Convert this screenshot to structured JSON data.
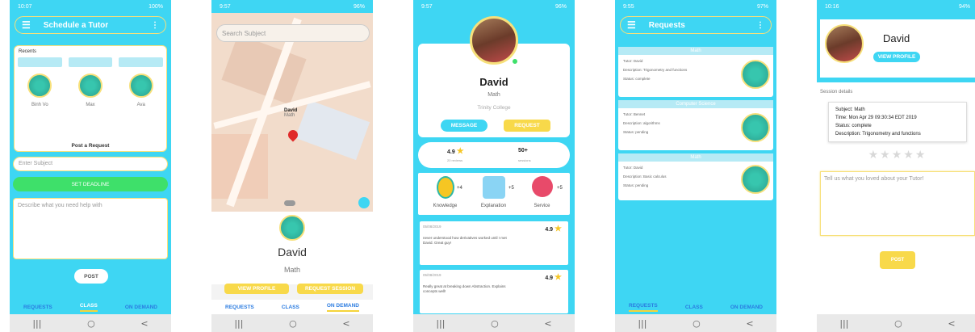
{
  "screen1": {
    "status_time": "10:07",
    "status_right": "100%",
    "title": "Schedule a Tutor",
    "recents_label": "Recents",
    "recent_names": [
      "Binh Vo",
      "Max",
      "Ava"
    ],
    "post_request": "Post a Request",
    "subject_placeholder": "Enter Subject",
    "deadline_button": "SET DEADLINE",
    "describe_placeholder": "Describe what you need help with",
    "post_button": "POST",
    "tabs": [
      "REQUESTS",
      "CLASS",
      "ON DEMAND"
    ]
  },
  "screen2": {
    "status_time": "9:57",
    "status_right": "96%",
    "search_placeholder": "Search Subject",
    "pin_name": "David",
    "pin_subject": "Math",
    "name": "David",
    "subject": "Math",
    "view_profile": "VIEW PROFILE",
    "request_session": "REQUEST SESSION",
    "tabs": [
      "REQUESTS",
      "CLASS",
      "ON DEMAND"
    ]
  },
  "screen3": {
    "status_time": "9:57",
    "status_right": "96%",
    "name": "David",
    "subject": "Math",
    "school": "Trinity College",
    "message": "MESSAGE",
    "request": "REQUEST",
    "rating": "4.9",
    "rating_sub": "20 reviews",
    "sessions": "50+",
    "sessions_sub": "sessions",
    "badges": [
      {
        "label": "Knowledge",
        "count": "+4"
      },
      {
        "label": "Explanation",
        "count": "+5"
      },
      {
        "label": "Service",
        "count": "+5"
      }
    ],
    "reviews": [
      {
        "date": "05/08/2019",
        "score": "4.9",
        "text": "never understood how derivatives worked until I met David. Great guy!"
      },
      {
        "date": "05/08/2019",
        "score": "4.9",
        "text": "Really great at breaking down Abstraction. Explains concepts well!"
      }
    ]
  },
  "screen4": {
    "status_time": "9:55",
    "status_right": "97%",
    "title": "Requests",
    "requests": [
      {
        "header": "Math",
        "tutor": "Tutor: David",
        "desc": "Description: Trigonometry and functions",
        "status": "Status: complete"
      },
      {
        "header": "Computer Science",
        "tutor": "Tutor: Bennet",
        "desc": "Description: algorithms",
        "status": "Status: pending"
      },
      {
        "header": "Math",
        "tutor": "Tutor: David",
        "desc": "Description: Basic calculus",
        "status": "Status: pending"
      }
    ],
    "tabs": [
      "REQUESTS",
      "CLASS",
      "ON DEMAND"
    ]
  },
  "screen5": {
    "status_time": "10:16",
    "status_right": "94%",
    "name": "David",
    "view_profile": "VIEW PROFILE",
    "session_details_label": "Session details",
    "subject": "Subject: Math",
    "time": "Time: Mon Apr 29 09:30:34 EDT 2019",
    "status": "Status: complete",
    "description": "Description: Trigonometry and functions",
    "stars": "★★★★★",
    "feedback_placeholder": "Tell us what you loved about your Tutor!",
    "post": "POST"
  },
  "nav": [
    "|||",
    "○",
    "<"
  ],
  "colors": {
    "primary": "#3ed6f3",
    "accent": "#f8d94a",
    "green": "#3ee06a",
    "avatar": "#2fb8a6"
  }
}
